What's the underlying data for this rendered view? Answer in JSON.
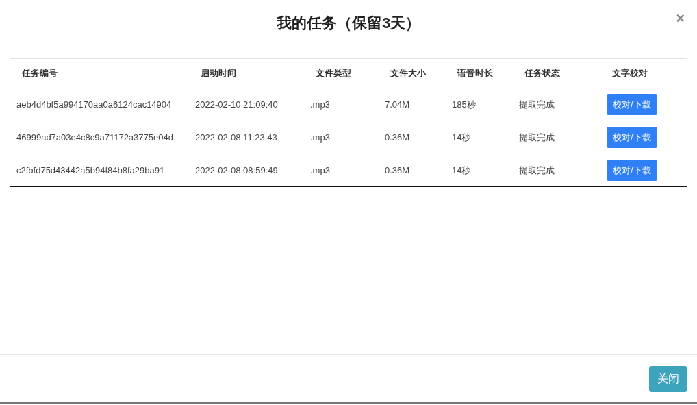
{
  "dialog": {
    "title": "我的任务（保留3天）",
    "close_icon": "×"
  },
  "table": {
    "columns": [
      "任务编号",
      "启动时间",
      "文件类型",
      "文件大小",
      "语音时长",
      "任务状态",
      "文字校对"
    ],
    "rows": [
      {
        "id": "aeb4d4bf5a994170aa0a6124cac14904",
        "start_time": "2022-02-10 21:09:40",
        "file_type": ".mp3",
        "file_size": "7.04M",
        "duration": "185秒",
        "status": "提取完成",
        "action": "校对/下载"
      },
      {
        "id": "46999ad7a03e4c8c9a71172a3775e04d",
        "start_time": "2022-02-08 11:23:43",
        "file_type": ".mp3",
        "file_size": "0.36M",
        "duration": "14秒",
        "status": "提取完成",
        "action": "校对/下载"
      },
      {
        "id": "c2fbfd75d43442a5b94f84b8fa29ba91",
        "start_time": "2022-02-08 08:59:49",
        "file_type": ".mp3",
        "file_size": "0.36M",
        "duration": "14秒",
        "status": "提取完成",
        "action": "校对/下载"
      }
    ]
  },
  "footer": {
    "close_button": "关闭"
  }
}
